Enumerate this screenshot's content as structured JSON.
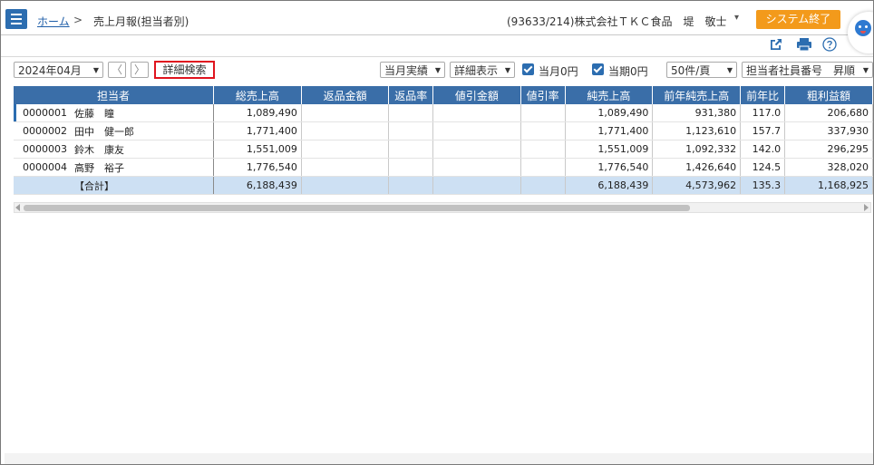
{
  "header": {
    "home_link": "ホーム",
    "separator": ">",
    "current_page": "売上月報(担当者別)",
    "company_user": "(93633/214)株式会社ＴＫＣ食品　堤　敬士",
    "user_caret": "▾",
    "exit_button": "システム終了"
  },
  "toolbar": {
    "month": "2024年04月",
    "prev": "〈",
    "next": "〉",
    "advanced_search": "詳細検索",
    "performance": "当月実績",
    "detail_display": "詳細表示",
    "check_current_zero": "当月0円",
    "check_period_zero": "当期0円",
    "page_size": "50件/頁",
    "sort": "担当者社員番号　昇順"
  },
  "table": {
    "headers": [
      "担当者",
      "総売上高",
      "返品金額",
      "返品率",
      "値引金額",
      "値引率",
      "純売上高",
      "前年純売上高",
      "前年比",
      "粗利益額"
    ],
    "rows": [
      [
        "0000001",
        "佐藤　瞳",
        "1,089,490",
        "",
        "",
        "",
        "",
        "1,089,490",
        "931,380",
        "117.0",
        "206,680"
      ],
      [
        "0000002",
        "田中　健一郎",
        "1,771,400",
        "",
        "",
        "",
        "",
        "1,771,400",
        "1,123,610",
        "157.7",
        "337,930"
      ],
      [
        "0000003",
        "鈴木　康友",
        "1,551,009",
        "",
        "",
        "",
        "",
        "1,551,009",
        "1,092,332",
        "142.0",
        "296,295"
      ],
      [
        "0000004",
        "高野　裕子",
        "1,776,540",
        "",
        "",
        "",
        "",
        "1,776,540",
        "1,426,640",
        "124.5",
        "328,020"
      ]
    ],
    "total": [
      "",
      "【合計】",
      "6,188,439",
      "",
      "",
      "",
      "",
      "6,188,439",
      "4,573,962",
      "135.3",
      "1,168,925"
    ]
  },
  "colors": {
    "header_blue": "#3a6ea8",
    "exit_orange": "#f39a1b",
    "total_row": "#cde0f3",
    "highlight_red": "#e0141e"
  },
  "icons": [
    "menu-icon",
    "export-icon",
    "print-icon",
    "help-icon",
    "chevron-down-icon",
    "checkbox-checked-icon"
  ]
}
